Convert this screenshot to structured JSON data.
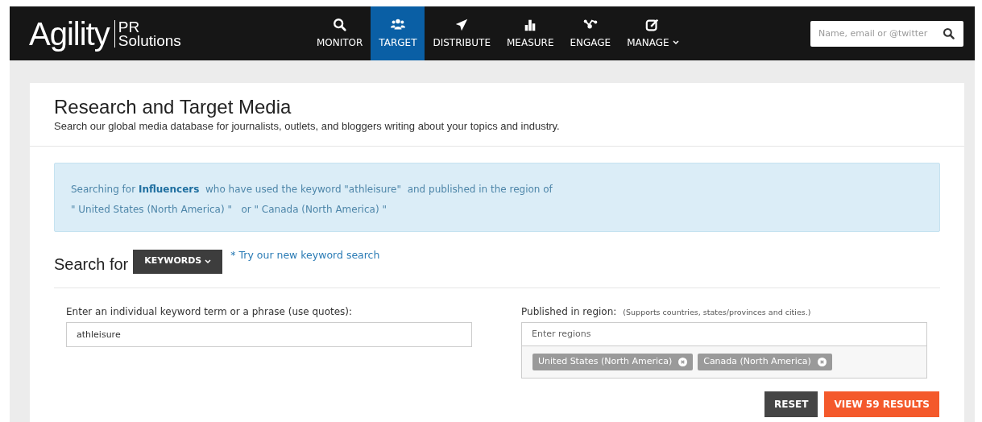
{
  "logo": {
    "main": "Agility",
    "sub_top": "PR",
    "sub_bottom": "Solutions"
  },
  "nav": [
    {
      "kind": "search",
      "label": "MONITOR",
      "selected": false,
      "dropdown": false
    },
    {
      "kind": "people",
      "label": "TARGET",
      "selected": true,
      "dropdown": false
    },
    {
      "kind": "plane",
      "label": "DISTRIBUTE",
      "selected": false,
      "dropdown": false
    },
    {
      "kind": "bars",
      "label": "MEASURE",
      "selected": false,
      "dropdown": false
    },
    {
      "kind": "nodes",
      "label": "ENGAGE",
      "selected": false,
      "dropdown": false
    },
    {
      "kind": "edit",
      "label": "MANAGE",
      "selected": false,
      "dropdown": true
    }
  ],
  "header_search": {
    "placeholder": "Name, email or @twitter"
  },
  "page": {
    "title": "Research and Target Media",
    "subtitle": "Search our global media database for journalists, outlets, and bloggers writing about your topics and industry."
  },
  "info": {
    "line1": "Searching for **Influencers**  who have used the keyword \"athleisure\"  and published in the region of",
    "line2": "\" United States (North America) \"   or \" Canada (North America) \""
  },
  "search_for": {
    "label": "Search for",
    "dropdown": "KEYWORDS",
    "link": "* Try our new keyword search"
  },
  "keyword": {
    "label": "Enter an individual keyword term or a phrase (use quotes):",
    "value": "athleisure"
  },
  "region": {
    "label": "Published in region:",
    "hint": "(Supports countries, states/provinces and cities.)",
    "placeholder": "Enter regions",
    "tags": [
      "United States (North America)",
      "Canada (North America)"
    ]
  },
  "buttons": [
    {
      "kind": "secondary",
      "label": "RESET"
    },
    {
      "kind": "primary",
      "label": "VIEW 59 RESULTS"
    }
  ]
}
